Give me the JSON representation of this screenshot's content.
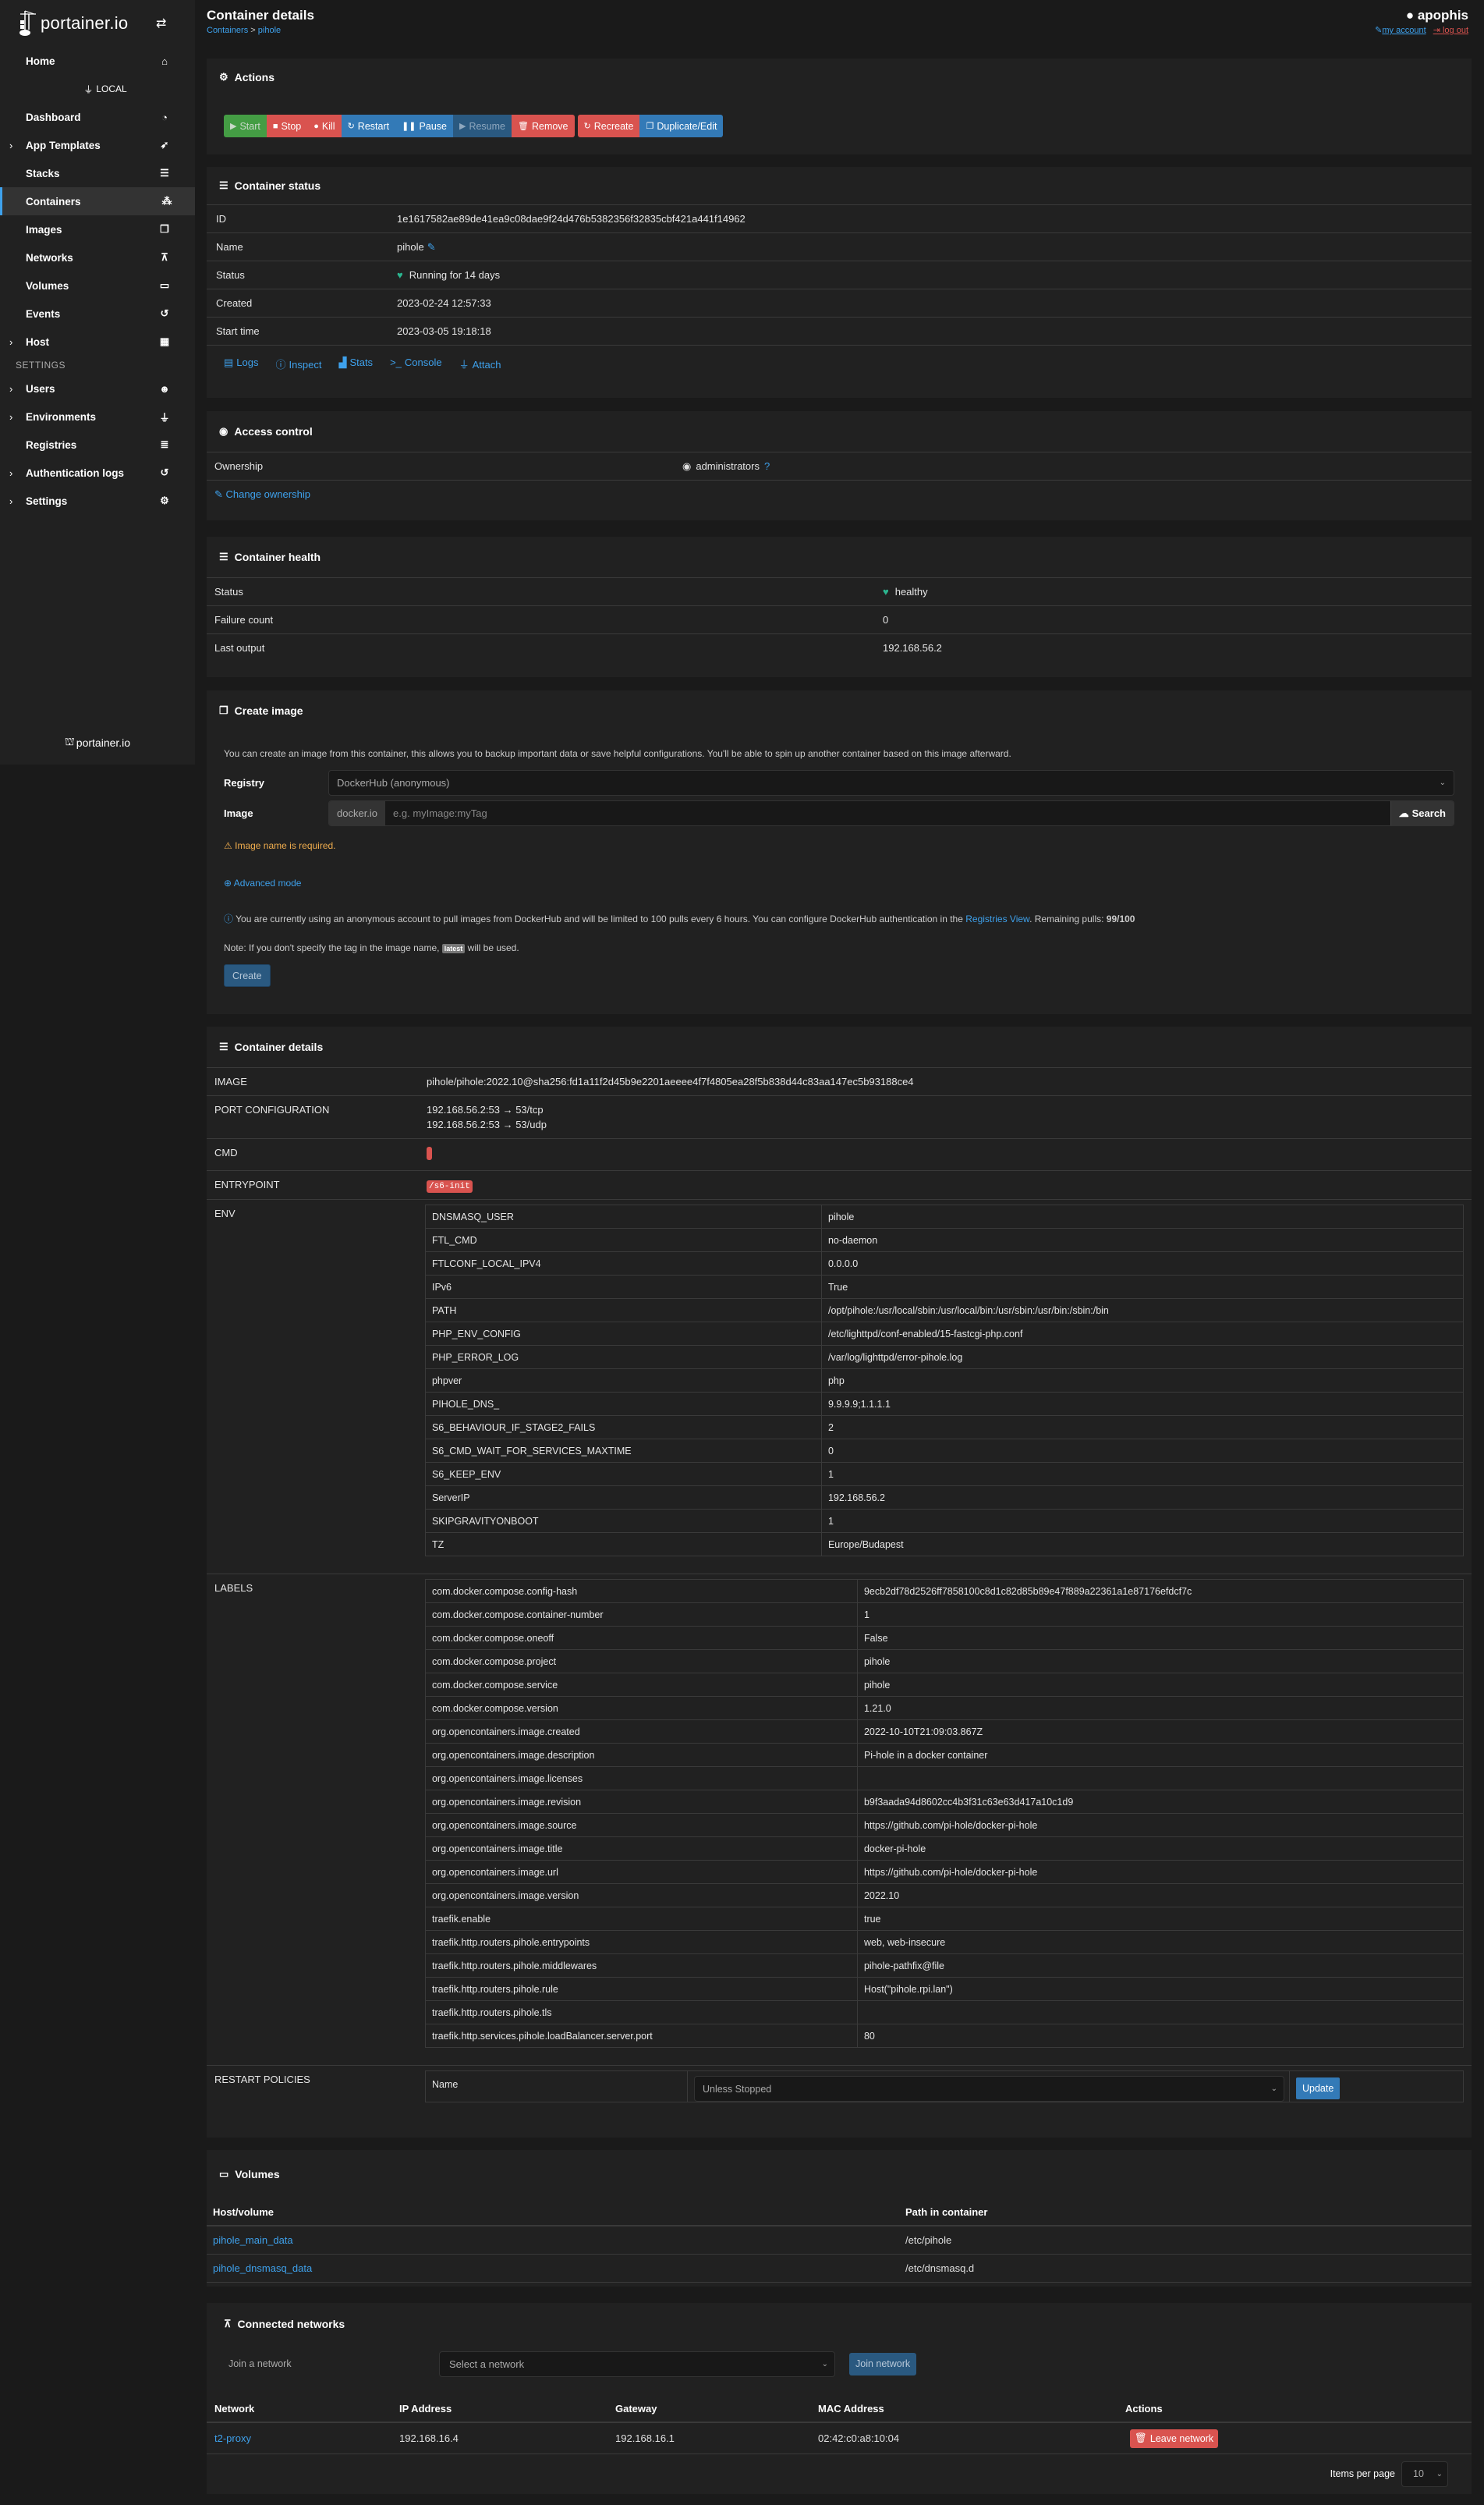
{
  "sidebar": {
    "logo_text": "portainer.io",
    "home": "Home",
    "environment": "LOCAL",
    "items": [
      {
        "label": "Dashboard",
        "icon": "tachometer-icon",
        "expandable": false
      },
      {
        "label": "App Templates",
        "icon": "rocket-icon",
        "expandable": true
      },
      {
        "label": "Stacks",
        "icon": "th-list-icon",
        "expandable": false
      },
      {
        "label": "Containers",
        "icon": "cubes-icon",
        "expandable": false,
        "active": true
      },
      {
        "label": "Images",
        "icon": "clone-icon",
        "expandable": false
      },
      {
        "label": "Networks",
        "icon": "sitemap-icon",
        "expandable": false
      },
      {
        "label": "Volumes",
        "icon": "hdd-icon",
        "expandable": false
      },
      {
        "label": "Events",
        "icon": "history-icon",
        "expandable": false
      },
      {
        "label": "Host",
        "icon": "th-icon",
        "expandable": true
      }
    ],
    "settings_heading": "SETTINGS",
    "settings_items": [
      {
        "label": "Users",
        "icon": "users-icon",
        "expandable": true
      },
      {
        "label": "Environments",
        "icon": "plug-icon",
        "expandable": true
      },
      {
        "label": "Registries",
        "icon": "database-icon",
        "expandable": false
      },
      {
        "label": "Authentication logs",
        "icon": "history-icon",
        "expandable": true
      },
      {
        "label": "Settings",
        "icon": "cogs-icon",
        "expandable": true
      }
    ],
    "footer_logo": "portainer.io"
  },
  "header": {
    "title": "Container details",
    "breadcrumb": [
      "Containers",
      "pihole"
    ],
    "username": "apophis",
    "my_account": "my account",
    "log_out": "log out"
  },
  "actions": {
    "title": "Actions",
    "buttons": [
      {
        "label": "Start",
        "icon": "play-icon",
        "style": "green"
      },
      {
        "label": "Stop",
        "icon": "stop-icon",
        "style": "red"
      },
      {
        "label": "Kill",
        "icon": "bomb-icon",
        "style": "red"
      },
      {
        "label": "Restart",
        "icon": "sync-icon",
        "style": "blue"
      },
      {
        "label": "Pause",
        "icon": "pause-icon",
        "style": "blue"
      },
      {
        "label": "Resume",
        "icon": "play-icon",
        "style": "blue-disabled"
      },
      {
        "label": "Remove",
        "icon": "trash-icon",
        "style": "red"
      }
    ],
    "buttons2": [
      {
        "label": "Recreate",
        "icon": "sync-icon",
        "style": "red"
      },
      {
        "label": "Duplicate/Edit",
        "icon": "copy-icon",
        "style": "blue"
      }
    ]
  },
  "status": {
    "title": "Container status",
    "rows": {
      "id_label": "ID",
      "id": "1e1617582ae89de41ea9c08dae9f24d476b5382356f32835cbf421a441f14962",
      "name_label": "Name",
      "name": "pihole",
      "status_label": "Status",
      "status": "Running for 14 days",
      "created_label": "Created",
      "created": "2023-02-24 12:57:33",
      "start_label": "Start time",
      "start": "2023-03-05 19:18:18"
    },
    "links": [
      "Logs",
      "Inspect",
      "Stats",
      "Console",
      "Attach"
    ]
  },
  "access": {
    "title": "Access control",
    "ownership_label": "Ownership",
    "ownership": "administrators",
    "change": "Change ownership"
  },
  "health": {
    "title": "Container health",
    "status_label": "Status",
    "status": "healthy",
    "failure_label": "Failure count",
    "failure": "0",
    "output_label": "Last output",
    "output": "192.168.56.2"
  },
  "create_image": {
    "title": "Create image",
    "description": "You can create an image from this container, this allows you to backup important data or save helpful configurations. You'll be able to spin up another container based on this image afterward.",
    "registry_label": "Registry",
    "registry_value": "DockerHub (anonymous)",
    "image_label": "Image",
    "image_prefix": "docker.io",
    "image_placeholder": "e.g. myImage:myTag",
    "image_value": "",
    "search": "Search",
    "warning": "Image name is required.",
    "advanced": "Advanced mode",
    "info_before": "You are currently using an anonymous account to pull images from DockerHub and will be limited to 100 pulls every 6 hours. You can configure DockerHub authentication in the ",
    "info_link": "Registries View",
    "info_after": ". Remaining pulls: ",
    "remaining": "99/100",
    "note_before": "Note: If you don't specify the tag in the image name, ",
    "note_badge": "latest",
    "note_after": " will be used.",
    "create": "Create"
  },
  "details": {
    "title": "Container details",
    "image_label": "IMAGE",
    "image": "pihole/pihole:2022.10@sha256:fd1a11f2d45b9e2201aeeee4f7f4805ea28f5b838d44c83aa147ec5b93188ce4",
    "ports_label": "PORT CONFIGURATION",
    "ports": [
      "192.168.56.2:53 → 53/tcp",
      "192.168.56.2:53 → 53/udp"
    ],
    "cmd_label": "CMD",
    "cmd": "",
    "entrypoint_label": "ENTRYPOINT",
    "entrypoint": "/s6-init",
    "env_label": "ENV",
    "env": [
      [
        "DNSMASQ_USER",
        "pihole"
      ],
      [
        "FTL_CMD",
        "no-daemon"
      ],
      [
        "FTLCONF_LOCAL_IPV4",
        "0.0.0.0"
      ],
      [
        "IPv6",
        "True"
      ],
      [
        "PATH",
        "/opt/pihole:/usr/local/sbin:/usr/local/bin:/usr/sbin:/usr/bin:/sbin:/bin"
      ],
      [
        "PHP_ENV_CONFIG",
        "/etc/lighttpd/conf-enabled/15-fastcgi-php.conf"
      ],
      [
        "PHP_ERROR_LOG",
        "/var/log/lighttpd/error-pihole.log"
      ],
      [
        "phpver",
        "php"
      ],
      [
        "PIHOLE_DNS_",
        "9.9.9.9;1.1.1.1"
      ],
      [
        "S6_BEHAVIOUR_IF_STAGE2_FAILS",
        "2"
      ],
      [
        "S6_CMD_WAIT_FOR_SERVICES_MAXTIME",
        "0"
      ],
      [
        "S6_KEEP_ENV",
        "1"
      ],
      [
        "ServerIP",
        "192.168.56.2"
      ],
      [
        "SKIPGRAVITYONBOOT",
        "1"
      ],
      [
        "TZ",
        "Europe/Budapest"
      ]
    ],
    "labels_label": "LABELS",
    "labels": [
      [
        "com.docker.compose.config-hash",
        "9ecb2df78d2526ff7858100c8d1c82d85b89e47f889a22361a1e87176efdcf7c"
      ],
      [
        "com.docker.compose.container-number",
        "1"
      ],
      [
        "com.docker.compose.oneoff",
        "False"
      ],
      [
        "com.docker.compose.project",
        "pihole"
      ],
      [
        "com.docker.compose.service",
        "pihole"
      ],
      [
        "com.docker.compose.version",
        "1.21.0"
      ],
      [
        "org.opencontainers.image.created",
        "2022-10-10T21:09:03.867Z"
      ],
      [
        "org.opencontainers.image.description",
        "Pi-hole in a docker container"
      ],
      [
        "org.opencontainers.image.licenses",
        ""
      ],
      [
        "org.opencontainers.image.revision",
        "b9f3aada94d8602cc4b3f31c63e63d417a10c1d9"
      ],
      [
        "org.opencontainers.image.source",
        "https://github.com/pi-hole/docker-pi-hole"
      ],
      [
        "org.opencontainers.image.title",
        "docker-pi-hole"
      ],
      [
        "org.opencontainers.image.url",
        "https://github.com/pi-hole/docker-pi-hole"
      ],
      [
        "org.opencontainers.image.version",
        "2022.10"
      ],
      [
        "traefik.enable",
        "true"
      ],
      [
        "traefik.http.routers.pihole.entrypoints",
        "web, web-insecure"
      ],
      [
        "traefik.http.routers.pihole.middlewares",
        "pihole-pathfix@file"
      ],
      [
        "traefik.http.routers.pihole.rule",
        "Host(\"pihole.rpi.lan\")"
      ],
      [
        "traefik.http.routers.pihole.tls",
        ""
      ],
      [
        "traefik.http.services.pihole.loadBalancer.server.port",
        "80"
      ]
    ],
    "restart_label": "RESTART POLICIES",
    "restart_name": "Name",
    "restart_value": "Unless Stopped",
    "update": "Update"
  },
  "volumes": {
    "title": "Volumes",
    "headers": [
      "Host/volume",
      "Path in container"
    ],
    "rows": [
      [
        "pihole_main_data",
        "/etc/pihole"
      ],
      [
        "pihole_dnsmasq_data",
        "/etc/dnsmasq.d"
      ]
    ]
  },
  "networks": {
    "title": "Connected networks",
    "join_label": "Join a network",
    "select_placeholder": "Select a network",
    "join_button": "Join network",
    "headers": [
      "Network",
      "IP Address",
      "Gateway",
      "MAC Address",
      "Actions"
    ],
    "rows": [
      {
        "network": "t2-proxy",
        "ip": "192.168.16.4",
        "gateway": "192.168.16.1",
        "mac": "02:42:c0:a8:10:04",
        "action": "Leave network"
      }
    ],
    "items_per_page_label": "Items per page",
    "items_per_page": "10"
  },
  "colors": {
    "accent": "#3ea1ec",
    "danger": "#d9534f",
    "primary": "#337ab7",
    "success": "#449d44",
    "healthy": "#2bb58f",
    "warning": "#f0ad4e"
  }
}
